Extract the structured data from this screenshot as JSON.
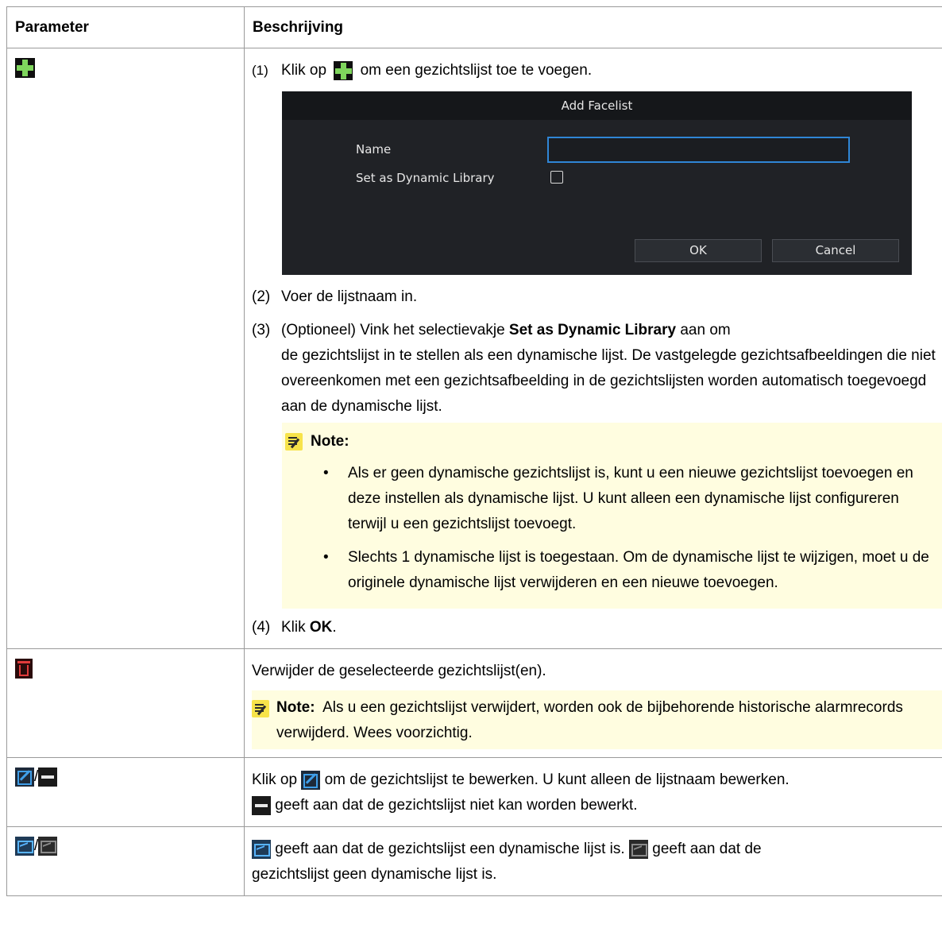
{
  "table": {
    "header_parameter": "Parameter",
    "header_description": "Beschrijving"
  },
  "row_add": {
    "icon": "plus-icon",
    "step1_num": "(1)",
    "step1_before": "Klik op",
    "step1_after": "om een gezichtslijst toe te voegen.",
    "dialog": {
      "title": "Add Facelist",
      "name_label": "Name",
      "name_value": "",
      "dynamic_label": "Set as Dynamic Library",
      "dynamic_checked": false,
      "ok_label": "OK",
      "cancel_label": "Cancel"
    },
    "step2_num": "(2)",
    "step2_text": "Voer de lijstnaam in.",
    "step3_num": "(3)",
    "step3_before": "(Optioneel) Vink het selectievakje",
    "step3_bold": "Set as Dynamic Library",
    "step3_after": "aan om",
    "step3_rest": "de gezichtslijst in te stellen als een dynamische lijst. De vastgelegde gezichtsafbeeldingen die niet overeenkomen met een gezichtsafbeelding in de gezichtslijsten worden automatisch toegevoegd aan de dynamische lijst.",
    "note_title": "Note:",
    "note_bullet1": "Als er geen dynamische gezichtslijst is, kunt u een nieuwe gezichtslijst toevoegen en deze instellen als dynamische lijst. U kunt alleen een dynamische lijst configureren terwijl u een gezichtslijst toevoegt.",
    "note_bullet2": "Slechts 1 dynamische lijst is toegestaan. Om de dynamische lijst te wijzigen, moet u de originele dynamische lijst verwijderen en een nieuwe toevoegen.",
    "step4_num": "(4)",
    "step4_before": "Klik",
    "step4_bold": "OK",
    "step4_after": "."
  },
  "row_delete": {
    "icon": "trash-icon",
    "text": "Verwijder de geselecteerde gezichtslijst(en).",
    "note_title": "Note:",
    "note_text": "Als u een gezichtslijst verwijdert, worden ook de bijbehorende historische alarmrecords verwijderd. Wees voorzichtig."
  },
  "row_edit": {
    "icons": [
      "edit-icon",
      "minus-icon"
    ],
    "separator": "/",
    "text_before": "Klik op",
    "text_after": "om de gezichtslijst te bewerken. U kunt alleen de lijstnaam bewerken.",
    "text2": "geeft aan dat de gezichtslijst niet kan worden bewerkt."
  },
  "row_dynamic": {
    "icons": [
      "dynamic-library-icon",
      "static-library-icon"
    ],
    "separator": "/",
    "text1": "geeft aan dat de gezichtslijst een dynamische lijst is.",
    "text2": "geeft aan dat de",
    "text3": "gezichtslijst geen dynamische lijst is."
  },
  "colors": {
    "border": "#9a9a9a",
    "note_bg": "#fffde0",
    "plus_green": "#7fd65d",
    "trash_red": "#e13c3c",
    "edit_blue": "#3f9ee8",
    "dialog_bg": "#202226"
  }
}
